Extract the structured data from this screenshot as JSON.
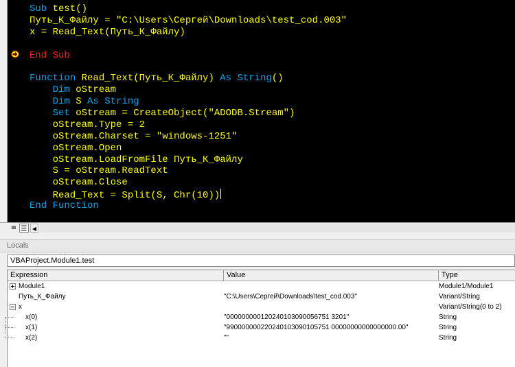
{
  "code": {
    "lines": [
      [
        {
          "t": "Sub ",
          "c": "kw"
        },
        {
          "t": "test()",
          "c": "ylw"
        }
      ],
      [
        {
          "t": "Путь_К_Файлу = \"C:\\Users\\Сергей\\Downloads\\test_cod.003\"",
          "c": "ylw"
        }
      ],
      [
        {
          "t": "x = Read_Text(Путь_К_Файлу)",
          "c": "ylw"
        }
      ],
      [],
      [
        {
          "t": "End Sub",
          "c": "err"
        }
      ],
      [],
      [
        {
          "t": "Function ",
          "c": "kw"
        },
        {
          "t": "Read_Text(Путь_К_Файлу) ",
          "c": "ylw"
        },
        {
          "t": "As String",
          "c": "kw"
        },
        {
          "t": "()",
          "c": "ylw"
        }
      ],
      [
        {
          "t": "    "
        },
        {
          "t": "Dim ",
          "c": "kw"
        },
        {
          "t": "oStream",
          "c": "ylw"
        }
      ],
      [
        {
          "t": "    "
        },
        {
          "t": "Dim ",
          "c": "kw"
        },
        {
          "t": "S ",
          "c": "ylw"
        },
        {
          "t": "As String",
          "c": "kw"
        }
      ],
      [
        {
          "t": "    "
        },
        {
          "t": "Set ",
          "c": "kw"
        },
        {
          "t": "oStream = CreateObject(\"ADODB.Stream\")",
          "c": "ylw"
        }
      ],
      [
        {
          "t": "    oStream.Type = 2",
          "c": "ylw"
        }
      ],
      [
        {
          "t": "    oStream.Charset = \"windows-1251\"",
          "c": "ylw"
        }
      ],
      [
        {
          "t": "    oStream.Open",
          "c": "ylw"
        }
      ],
      [
        {
          "t": "    oStream.LoadFromFile Путь_К_Файлу",
          "c": "ylw"
        }
      ],
      [
        {
          "t": "    S = oStream.ReadText",
          "c": "ylw"
        }
      ],
      [
        {
          "t": "    oStream.Close",
          "c": "ylw"
        }
      ],
      [
        {
          "t": "    Read_Text = Split(S, Chr(10))",
          "c": "ylw",
          "cursor": true
        }
      ],
      [
        {
          "t": "End Function",
          "c": "kw"
        }
      ]
    ]
  },
  "colors": {
    "keyword": "#00a6f0",
    "identifier": "#ffff00",
    "error": "#ff2020",
    "background": "#000000"
  },
  "locals": {
    "title": "Locals",
    "context": "VBAProject.Module1.test",
    "columns": {
      "expression": "Expression",
      "value": "Value",
      "type": "Type"
    },
    "rows": [
      {
        "expression": "Module1",
        "value": "",
        "type": "Module1/Module1"
      },
      {
        "expression": "Путь_К_Файлу",
        "value": "\"C:\\Users\\Сергей\\Downloads\\test_cod.003\"",
        "type": "Variant/String"
      },
      {
        "expression": "x",
        "value": "",
        "type": "Variant/String(0 to 2)"
      },
      {
        "expression": "x(0)",
        "value": "\"000000000120240103090056751  3201\"",
        "type": "String"
      },
      {
        "expression": "x(1)",
        "value": "\"990000000220240103090105751  00000000000000000.00\"",
        "type": "String"
      },
      {
        "expression": "x(2)",
        "value": "\"\"",
        "type": "String"
      }
    ]
  }
}
